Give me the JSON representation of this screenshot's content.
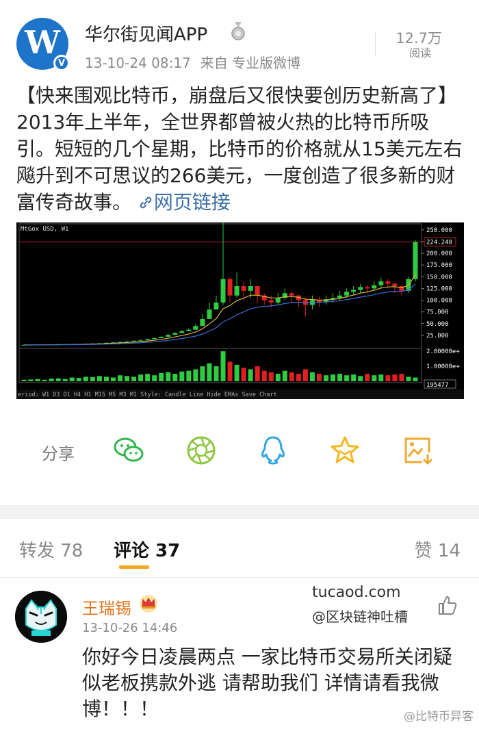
{
  "header": {
    "author": "华尔街见闻APP",
    "timestamp": "13-10-24 08:17",
    "source": "来自 专业版微博",
    "read_count": "12.7万",
    "read_label": "阅读",
    "avatar_letter": "W",
    "verified_mark": "V"
  },
  "post": {
    "text": "【快来围观比特币，崩盘后又很快要创历史新高了】2013年上半年，全世界都曾被火热的比特币所吸引。短短的几个星期，比特币的价格就从15美元左右飚升到不可思议的266美元，一度创造了很多新的财富传奇故事。",
    "link_label": "网页链接",
    "link_icon": "link-icon"
  },
  "chart": {
    "title": "MtGox USD, W1",
    "price_line_label": "224.240",
    "volume_label": "195477",
    "toolbar": "eriod: W1 D3 D1 H4 H1 M15 M5 M3 M1  Style: Candle Line  Hide EMAs  Save Chart"
  },
  "chart_data": {
    "type": "candlestick",
    "series_name": "MtGox USD, W1",
    "ylim": [
      0,
      260
    ],
    "y_ticks": [
      "250.000",
      "225.000",
      "200.000",
      "175.000",
      "150.000",
      "125.000",
      "100.000",
      "75.000",
      "50.000",
      "25.000"
    ],
    "volume_ticks": [
      "2.00000e+",
      "1.00000e+"
    ],
    "current_price": 224.24,
    "current_volume": 195477,
    "close": [
      4.5,
      4.8,
      5.0,
      5.2,
      5.4,
      5.6,
      5.8,
      6.0,
      6.5,
      7.0,
      7.5,
      8.0,
      9.0,
      10.0,
      11.0,
      12.0,
      13.5,
      15.0,
      17.0,
      19.0,
      22.0,
      26.0,
      30.0,
      34.0,
      37.0,
      45.0,
      60.0,
      80.0,
      95.0,
      145.0,
      110.0,
      130.0,
      120.0,
      130.0,
      110.0,
      100.0,
      95.0,
      105.0,
      115.0,
      110.0,
      100.0,
      90.0,
      100.0,
      96.0,
      102.0,
      105.0,
      110.0,
      118.0,
      122.0,
      128.0,
      125.0,
      132.0,
      140.0,
      135.0,
      130.0,
      120.0,
      145.0,
      224.0
    ],
    "high": [
      5.0,
      5.2,
      5.5,
      5.6,
      5.8,
      6.0,
      6.2,
      6.5,
      7.0,
      7.5,
      8.0,
      8.5,
      9.5,
      10.5,
      11.5,
      12.5,
      14.0,
      16.0,
      18.0,
      20.0,
      23.0,
      28.0,
      32.0,
      36.0,
      40.0,
      50.0,
      70.0,
      95.0,
      110.0,
      266.0,
      150.0,
      160.0,
      140.0,
      145.0,
      130.0,
      115.0,
      110.0,
      115.0,
      125.0,
      120.0,
      112.0,
      105.0,
      110.0,
      108.0,
      110.0,
      115.0,
      120.0,
      125.0,
      130.0,
      135.0,
      132.0,
      140.0,
      148.0,
      145.0,
      138.0,
      132.0,
      150.0,
      228.0
    ],
    "low": [
      4.0,
      4.3,
      4.6,
      4.8,
      5.0,
      5.2,
      5.4,
      5.6,
      6.0,
      6.4,
      6.8,
      7.5,
      8.5,
      9.5,
      10.5,
      11.5,
      13.0,
      14.5,
      16.5,
      18.5,
      21.0,
      25.0,
      29.0,
      32.0,
      35.0,
      40.0,
      55.0,
      75.0,
      85.0,
      90.0,
      95.0,
      105.0,
      100.0,
      105.0,
      95.0,
      90.0,
      85.0,
      90.0,
      100.0,
      95.0,
      85.0,
      65.0,
      80.0,
      85.0,
      90.0,
      95.0,
      100.0,
      105.0,
      110.0,
      115.0,
      115.0,
      120.0,
      125.0,
      125.0,
      115.0,
      110.0,
      115.0,
      140.0
    ],
    "volume": [
      0.1,
      0.12,
      0.15,
      0.1,
      0.18,
      0.2,
      0.15,
      0.25,
      0.22,
      0.3,
      0.28,
      0.35,
      0.3,
      0.25,
      0.4,
      0.35,
      0.3,
      0.45,
      0.5,
      0.4,
      0.55,
      0.6,
      0.5,
      0.65,
      0.7,
      0.8,
      1.0,
      1.2,
      1.0,
      2.0,
      1.3,
      1.1,
      0.9,
      0.8,
      1.0,
      0.7,
      0.6,
      0.5,
      0.7,
      0.6,
      0.5,
      0.8,
      0.6,
      0.5,
      0.4,
      0.45,
      0.5,
      0.4,
      0.45,
      0.35,
      0.5,
      0.4,
      0.45,
      0.4,
      0.45,
      0.5,
      0.3,
      0.25
    ]
  },
  "share": {
    "label": "分享",
    "icons": [
      "wechat-icon",
      "moments-icon",
      "qq-icon",
      "favorite-icon",
      "save-image-icon"
    ]
  },
  "tabs": {
    "repost": "转发 78",
    "comments": "评论 37",
    "likes": "赞 14"
  },
  "comment": {
    "author": "王瑞锡",
    "time": "13-10-26 14:46",
    "text": "你好今日凌晨两点 一家比特币交易所关闭疑似老板携款外逃 请帮助我们 详情请看我微博！！！",
    "watermark_site": "tucaod.com",
    "watermark_handle": "@区块链神吐槽"
  },
  "footer_watermark": "@比特币异客"
}
